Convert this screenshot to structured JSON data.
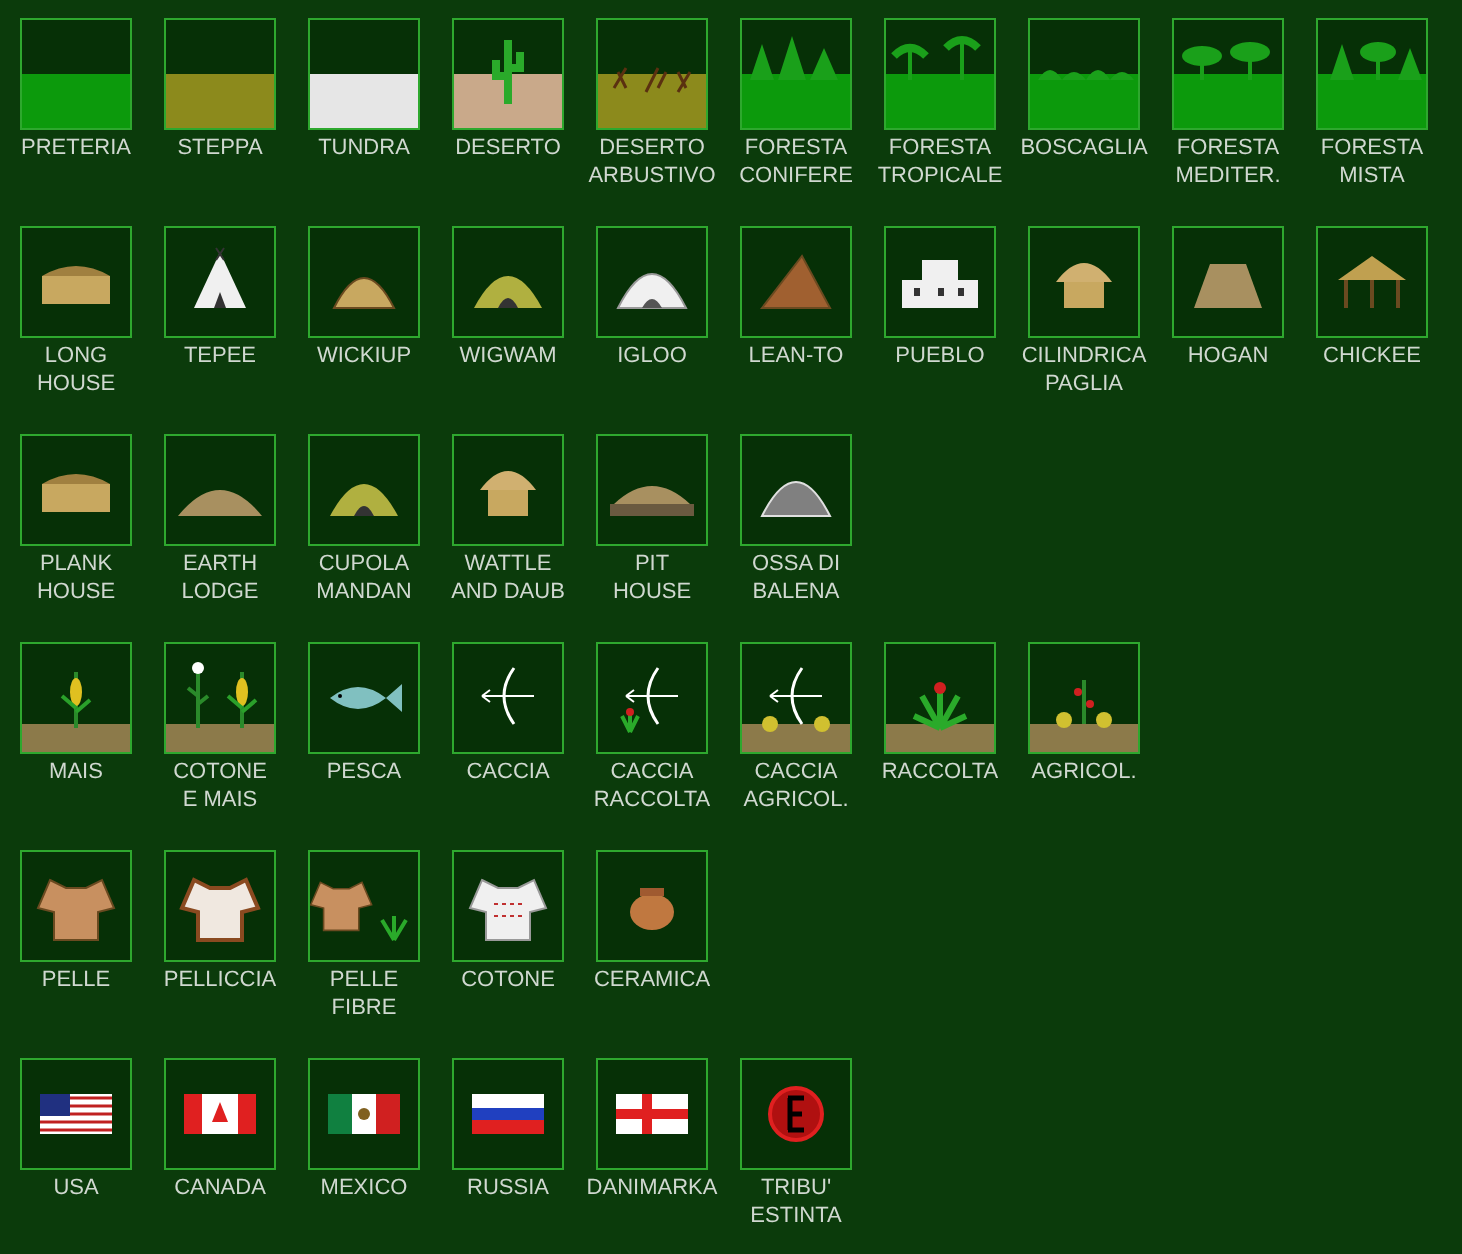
{
  "rows": [
    {
      "items": [
        {
          "label": [
            "PRETERIA"
          ],
          "kind": "band",
          "color": "#0c9a0c"
        },
        {
          "label": [
            "STEPPA"
          ],
          "kind": "band",
          "color": "#8c8a1c"
        },
        {
          "label": [
            "TUNDRA"
          ],
          "kind": "band",
          "color": "#e6e6e6"
        },
        {
          "label": [
            "DESERTO"
          ],
          "kind": "desert",
          "color": "#c9a98a"
        },
        {
          "label": [
            "DESERTO",
            "ARBUSTIVO"
          ],
          "kind": "shrub",
          "color": "#8c8a1c"
        },
        {
          "label": [
            "FORESTA",
            "CONIFERE"
          ],
          "kind": "conifer",
          "color": "#0c9a0c"
        },
        {
          "label": [
            "FORESTA",
            "TROPICALE"
          ],
          "kind": "tropical",
          "color": "#0c9a0c"
        },
        {
          "label": [
            "BOSCAGLIA"
          ],
          "kind": "scrub",
          "color": "#0c9a0c"
        },
        {
          "label": [
            "FORESTA",
            "MEDITER."
          ],
          "kind": "mediterranean",
          "color": "#0c9a0c"
        },
        {
          "label": [
            "FORESTA",
            "MISTA"
          ],
          "kind": "mixed",
          "color": "#0c9a0c"
        }
      ]
    },
    {
      "items": [
        {
          "label": [
            "LONG",
            "HOUSE"
          ],
          "kind": "longhouse"
        },
        {
          "label": [
            "TEPEE"
          ],
          "kind": "tepee"
        },
        {
          "label": [
            "WICKIUP"
          ],
          "kind": "wickiup"
        },
        {
          "label": [
            "WIGWAM"
          ],
          "kind": "wigwam"
        },
        {
          "label": [
            "IGLOO"
          ],
          "kind": "igloo"
        },
        {
          "label": [
            "LEAN-TO"
          ],
          "kind": "leanto"
        },
        {
          "label": [
            "PUEBLO"
          ],
          "kind": "pueblo"
        },
        {
          "label": [
            "CILINDRICA",
            "PAGLIA"
          ],
          "kind": "thatch"
        },
        {
          "label": [
            "HOGAN"
          ],
          "kind": "hogan"
        },
        {
          "label": [
            "CHICKEE"
          ],
          "kind": "chickee"
        }
      ]
    },
    {
      "items": [
        {
          "label": [
            "PLANK",
            "HOUSE"
          ],
          "kind": "longhouse"
        },
        {
          "label": [
            "EARTH",
            "LODGE"
          ],
          "kind": "earthlodge"
        },
        {
          "label": [
            "CUPOLA",
            "MANDAN"
          ],
          "kind": "wigwam"
        },
        {
          "label": [
            "WATTLE",
            "AND DAUB"
          ],
          "kind": "thatch"
        },
        {
          "label": [
            "PIT",
            "HOUSE"
          ],
          "kind": "pithouse"
        },
        {
          "label": [
            "OSSA DI",
            "BALENA"
          ],
          "kind": "whalebone"
        }
      ]
    },
    {
      "items": [
        {
          "label": [
            "MAIS"
          ],
          "kind": "corn"
        },
        {
          "label": [
            "COTONE",
            "E MAIS"
          ],
          "kind": "cottoncorn"
        },
        {
          "label": [
            "PESCA"
          ],
          "kind": "fish"
        },
        {
          "label": [
            "CACCIA"
          ],
          "kind": "bow"
        },
        {
          "label": [
            "CACCIA",
            "RACCOLTA"
          ],
          "kind": "bowplant"
        },
        {
          "label": [
            "CACCIA",
            "AGRICOL."
          ],
          "kind": "bowcrops"
        },
        {
          "label": [
            "RACCOLTA"
          ],
          "kind": "plant"
        },
        {
          "label": [
            "AGRICOL."
          ],
          "kind": "crops"
        }
      ]
    },
    {
      "items": [
        {
          "label": [
            "PELLE"
          ],
          "kind": "hide"
        },
        {
          "label": [
            "PELLICCIA"
          ],
          "kind": "fur"
        },
        {
          "label": [
            "PELLE",
            "FIBRE"
          ],
          "kind": "hideplant"
        },
        {
          "label": [
            "COTONE"
          ],
          "kind": "shirt"
        },
        {
          "label": [
            "CERAMICA"
          ],
          "kind": "pot"
        }
      ]
    },
    {
      "items": [
        {
          "label": [
            "USA"
          ],
          "kind": "usa"
        },
        {
          "label": [
            "CANADA"
          ],
          "kind": "canada"
        },
        {
          "label": [
            "MEXICO"
          ],
          "kind": "mexico"
        },
        {
          "label": [
            "RUSSIA"
          ],
          "kind": "russia"
        },
        {
          "label": [
            "DANIMARKA"
          ],
          "kind": "denmark"
        },
        {
          "label": [
            "TRIBU'",
            "ESTINTA"
          ],
          "kind": "extinct"
        }
      ]
    }
  ]
}
